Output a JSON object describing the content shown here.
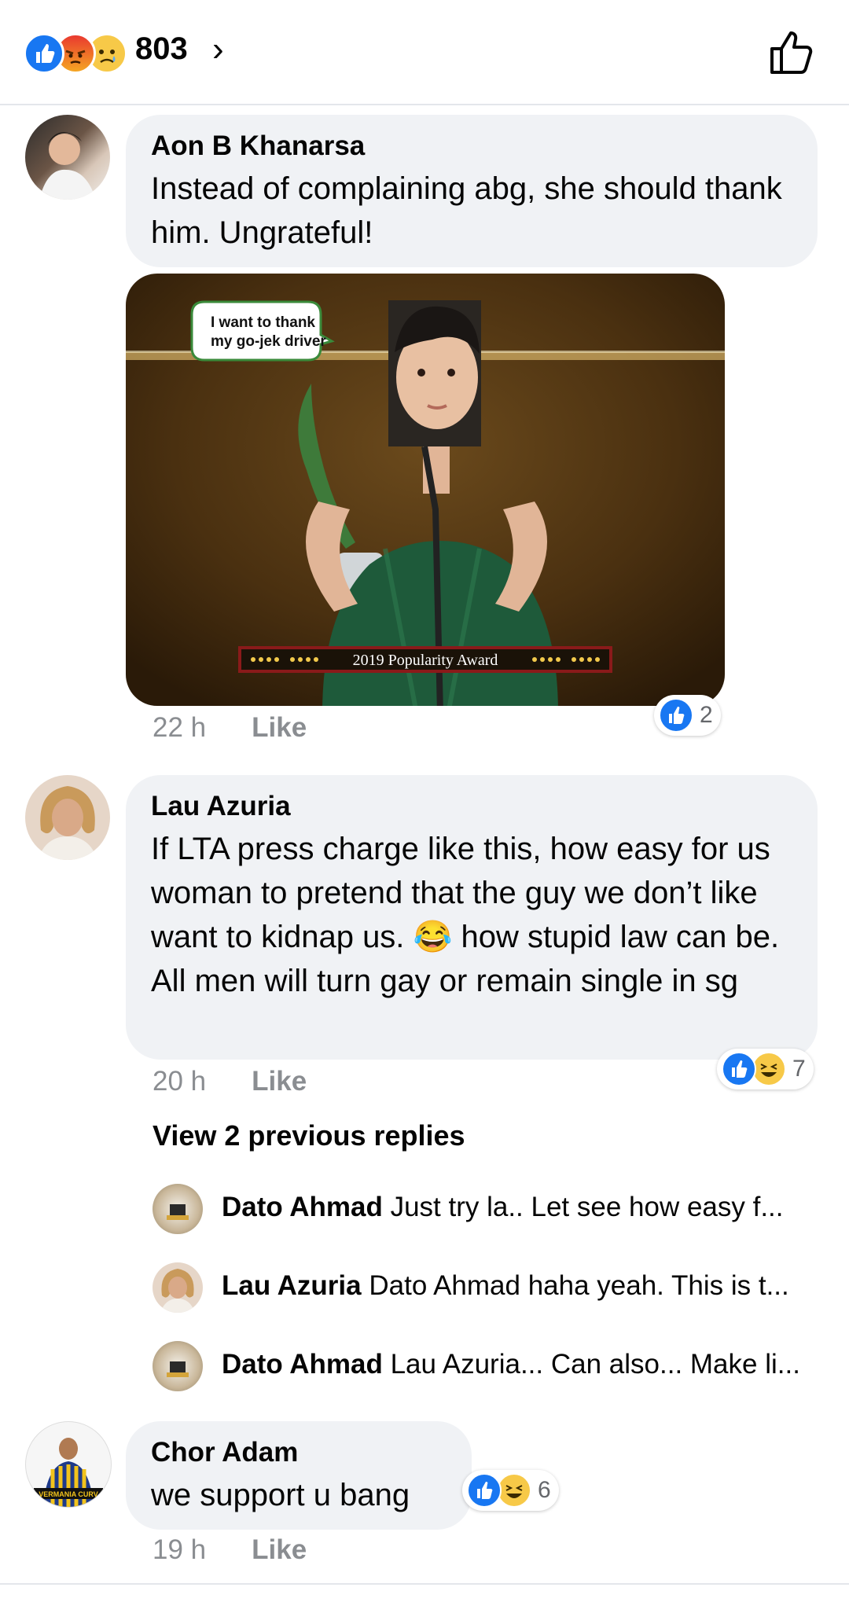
{
  "header": {
    "reaction_total": "803",
    "chevron": "›",
    "reactions": [
      "like-icon",
      "angry-icon",
      "sad-icon"
    ]
  },
  "colors": {
    "facebook_blue": "#1877f2",
    "bubble_bg": "#f0f2f5",
    "meta_gray": "#8a8d91"
  },
  "comments": [
    {
      "author": "Aon B Khanarsa",
      "text": "Instead of complaining abg, she should thank him. Ungrateful!",
      "time": "22 h",
      "like_label": "Like",
      "reaction_count": "2",
      "image": {
        "speech_bubble": "I want to thank my go-jek driver",
        "banner": "2019 Popularity Award"
      }
    },
    {
      "author": "Lau Azuria",
      "text": "If LTA press charge like this, how easy for us woman to pretend that the guy we don’t like want to kidnap  us. 😂 how stupid law can be. All men will turn gay or remain single in sg",
      "time": "20 h",
      "like_label": "Like",
      "reaction_count": "7"
    },
    {
      "author": "Chor Adam",
      "text": "we support u bang",
      "time": "19 h",
      "like_label": "Like",
      "reaction_count": "6",
      "avatar_text": "VERMANIA CURV"
    }
  ],
  "replies": {
    "view_previous": "View 2 previous replies",
    "items": [
      {
        "author": "Dato Ahmad",
        "text": "Just try la.. Let see how easy f..."
      },
      {
        "author": "Lau Azuria",
        "text": "Dato Ahmad haha yeah. This is t..."
      },
      {
        "author": "Dato Ahmad",
        "text": "Lau Azuria... Can also... Make li..."
      }
    ]
  }
}
